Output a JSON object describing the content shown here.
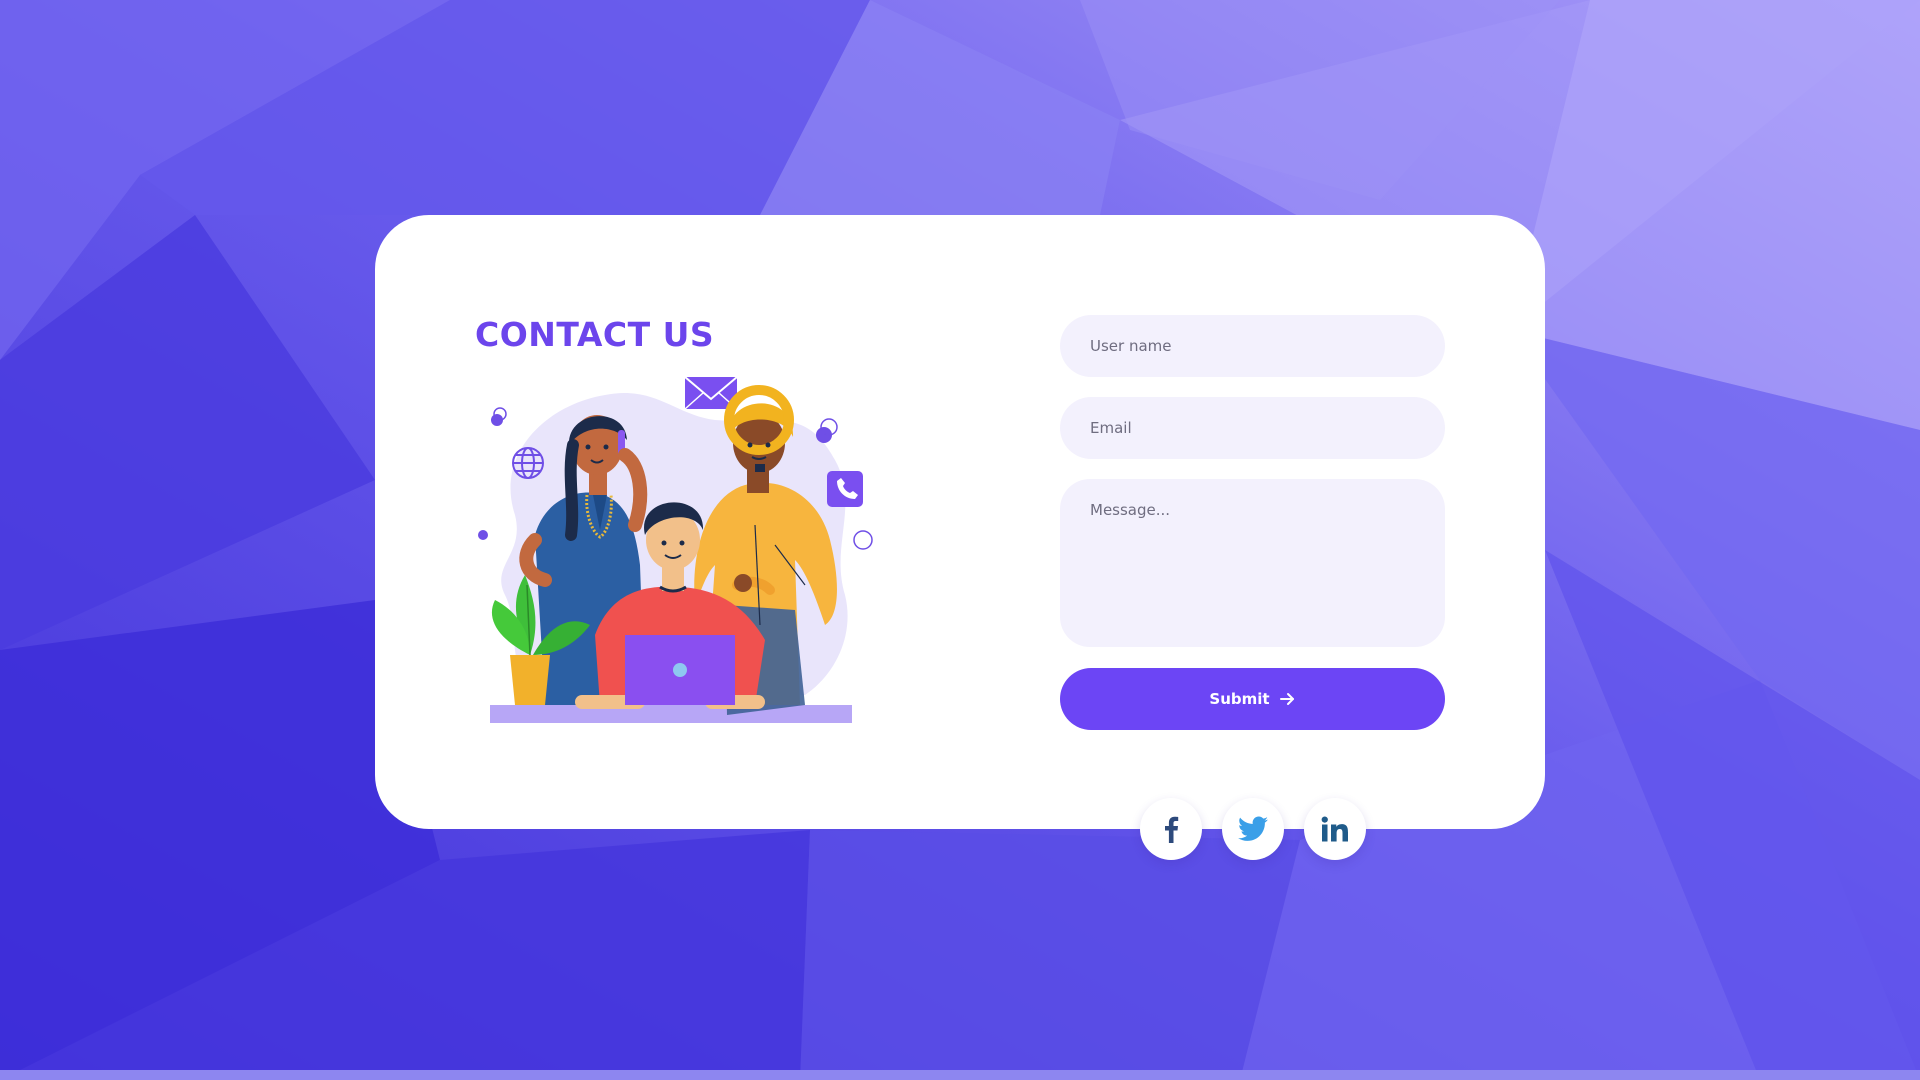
{
  "contact": {
    "title": "CONTACT US"
  },
  "form": {
    "username_placeholder": "User name",
    "email_placeholder": "Email",
    "message_placeholder": "Message...",
    "submit_label": "Submit"
  },
  "socials": [
    {
      "icon": "facebook-icon",
      "color": "#2d4a7c"
    },
    {
      "icon": "twitter-icon",
      "color": "#3a9fe8"
    },
    {
      "icon": "linkedin-icon",
      "color": "#1f5b8a"
    }
  ],
  "colors": {
    "accent": "#6c45ec",
    "button": "#6c45f5",
    "field_bg": "#f3f1fd",
    "background": "#5a4ae6"
  }
}
